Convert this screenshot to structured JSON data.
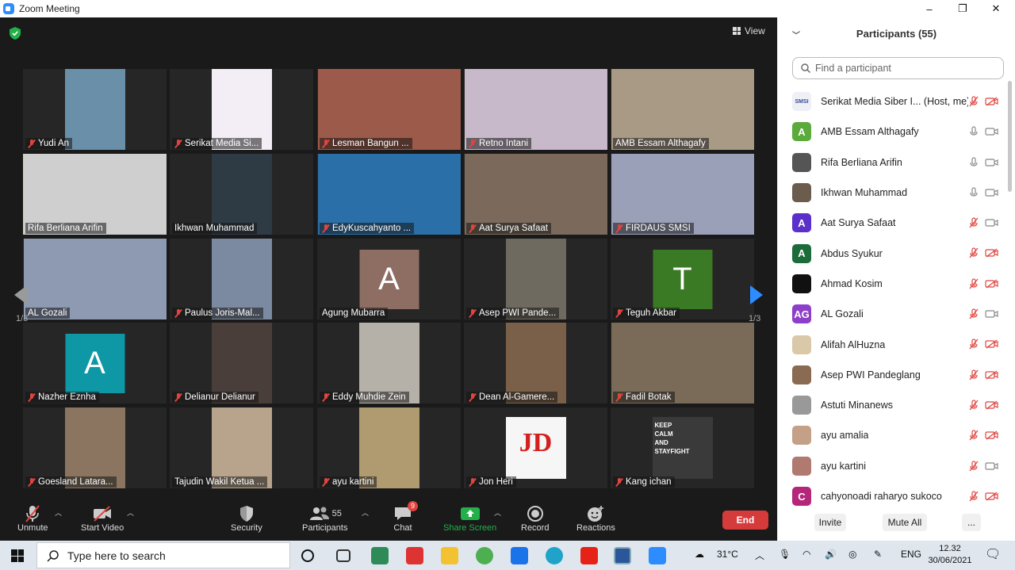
{
  "window": {
    "title": "Zoom Meeting",
    "min": "–",
    "restore": "❐",
    "close": "✕"
  },
  "meeting": {
    "view_label": "View",
    "page_indicator_left": "1/3",
    "page_indicator_right": "1/3",
    "tiles": [
      {
        "name": "Yudi An",
        "muted": true,
        "color": "#6a8fa8"
      },
      {
        "name": "Serikat Media Si...",
        "muted": true,
        "color": "#f3eef6"
      },
      {
        "name": "Lesman Bangun ...",
        "muted": true,
        "color": "#9c5a4a"
      },
      {
        "name": "Retno Intani",
        "muted": true,
        "color": "#c7b9c9"
      },
      {
        "name": "AMB Essam Althagafy",
        "muted": false,
        "color": "#a89a85"
      },
      {
        "name": "Rifa Berliana Arifin",
        "muted": false,
        "color": "#cfcfcf"
      },
      {
        "name": "Ikhwan Muhammad",
        "muted": false,
        "color": "#2e3a44"
      },
      {
        "name": "EdyKuscahyanto ...",
        "muted": true,
        "color": "#2a6fa8"
      },
      {
        "name": "Aat Surya Safaat",
        "muted": true,
        "color": "#7b6a5c"
      },
      {
        "name": "FIRDAUS SMSI",
        "muted": true,
        "color": "#9aa0b8"
      },
      {
        "name": "AL Gozali",
        "muted": false,
        "color": "#8d9ab1"
      },
      {
        "name": "Paulus Joris-Mal...",
        "muted": true,
        "color": "#7b8aa0"
      },
      {
        "name": "Agung Mubarra",
        "muted": false,
        "letter": "A",
        "color": "#8e6e63"
      },
      {
        "name": "Asep PWI Pande...",
        "muted": true,
        "color": "#6f6a60"
      },
      {
        "name": "Teguh Akbar",
        "muted": true,
        "letter": "T",
        "color": "#3a7a24"
      },
      {
        "name": "Nazher Eznha",
        "muted": true,
        "letter": "A",
        "color": "#0e97a5"
      },
      {
        "name": "Delianur Delianur",
        "muted": true,
        "color": "#4a3e3a"
      },
      {
        "name": "Eddy Muhdie Zein",
        "muted": true,
        "color": "#b5b0a8"
      },
      {
        "name": "Dean Al-Gamere...",
        "muted": true,
        "color": "#7a6048"
      },
      {
        "name": "Fadil Botak",
        "muted": true,
        "color": "#7a6a58"
      },
      {
        "name": "Goesland Latara...",
        "muted": true,
        "color": "#8b7560"
      },
      {
        "name": "Tajudin Wakil Ketua ...",
        "muted": false,
        "color": "#b8a48c"
      },
      {
        "name": "ayu kartini",
        "muted": true,
        "color": "#b09a70"
      },
      {
        "name": "Jon Heri",
        "muted": true,
        "color": "#f6f6f6",
        "logo": "JD"
      },
      {
        "name": "Kang ichan",
        "muted": true,
        "color": "#3a3a3a",
        "poster": [
          "KEEP",
          "CALM",
          "AND",
          "STAYFIGHT"
        ]
      }
    ]
  },
  "toolbar": {
    "unmute": "Unmute",
    "start_video": "Start Video",
    "security": "Security",
    "participants": "Participants",
    "participants_count": "55",
    "chat": "Chat",
    "chat_badge": "9",
    "share_screen": "Share Screen",
    "record": "Record",
    "reactions": "Reactions",
    "end": "End"
  },
  "panel": {
    "title": "Participants (55)",
    "search_placeholder": "Find a participant",
    "participants": [
      {
        "name": "Serikat Media Siber I... (Host, me)",
        "initials": "SMSI",
        "color": "#eef0f6",
        "mic": "muted",
        "cam": "off"
      },
      {
        "name": "AMB Essam Althagafy",
        "initials": "A",
        "color": "#5aab3c",
        "mic": "on",
        "cam": "on"
      },
      {
        "name": "Rifa Berliana Arifin",
        "initials": "",
        "color": "#555555",
        "mic": "on",
        "cam": "on"
      },
      {
        "name": "Ikhwan Muhammad",
        "initials": "",
        "color": "#6b5c4e",
        "mic": "on",
        "cam": "on"
      },
      {
        "name": "Aat Surya Safaat",
        "initials": "A",
        "color": "#5b2fc9",
        "mic": "muted",
        "cam": "on"
      },
      {
        "name": "Abdus Syukur",
        "initials": "A",
        "color": "#1c6b3a",
        "mic": "muted",
        "cam": "off"
      },
      {
        "name": "Ahmad Kosim",
        "initials": "",
        "color": "#111111",
        "mic": "muted",
        "cam": "off"
      },
      {
        "name": "AL Gozali",
        "initials": "AG",
        "color": "#8e3fc9",
        "mic": "muted",
        "cam": "on"
      },
      {
        "name": "Alifah AlHuzna",
        "initials": "",
        "color": "#d9c9a8",
        "mic": "muted",
        "cam": "off"
      },
      {
        "name": "Asep PWI Pandeglang",
        "initials": "",
        "color": "#8a6a50",
        "mic": "muted",
        "cam": "off"
      },
      {
        "name": "Astuti Minanews",
        "initials": "",
        "color": "#999999",
        "mic": "muted",
        "cam": "off"
      },
      {
        "name": "ayu amalia",
        "initials": "",
        "color": "#c4a088",
        "mic": "muted",
        "cam": "off"
      },
      {
        "name": "ayu kartini",
        "initials": "",
        "color": "#b07a70",
        "mic": "muted",
        "cam": "on"
      },
      {
        "name": "cahyonoadi raharyo sukoco",
        "initials": "C",
        "color": "#b5267a",
        "mic": "muted",
        "cam": "off"
      }
    ],
    "invite": "Invite",
    "mute_all": "Mute All",
    "more": "..."
  },
  "taskbar": {
    "search_placeholder": "Type here to search",
    "weather": "31°C",
    "lang": "ENG",
    "time": "12.32",
    "date": "30/06/2021"
  },
  "colors": {
    "accent": "#2d8cff",
    "end": "#d63b3b",
    "muted": "#e0443f",
    "share": "#23b04a"
  }
}
